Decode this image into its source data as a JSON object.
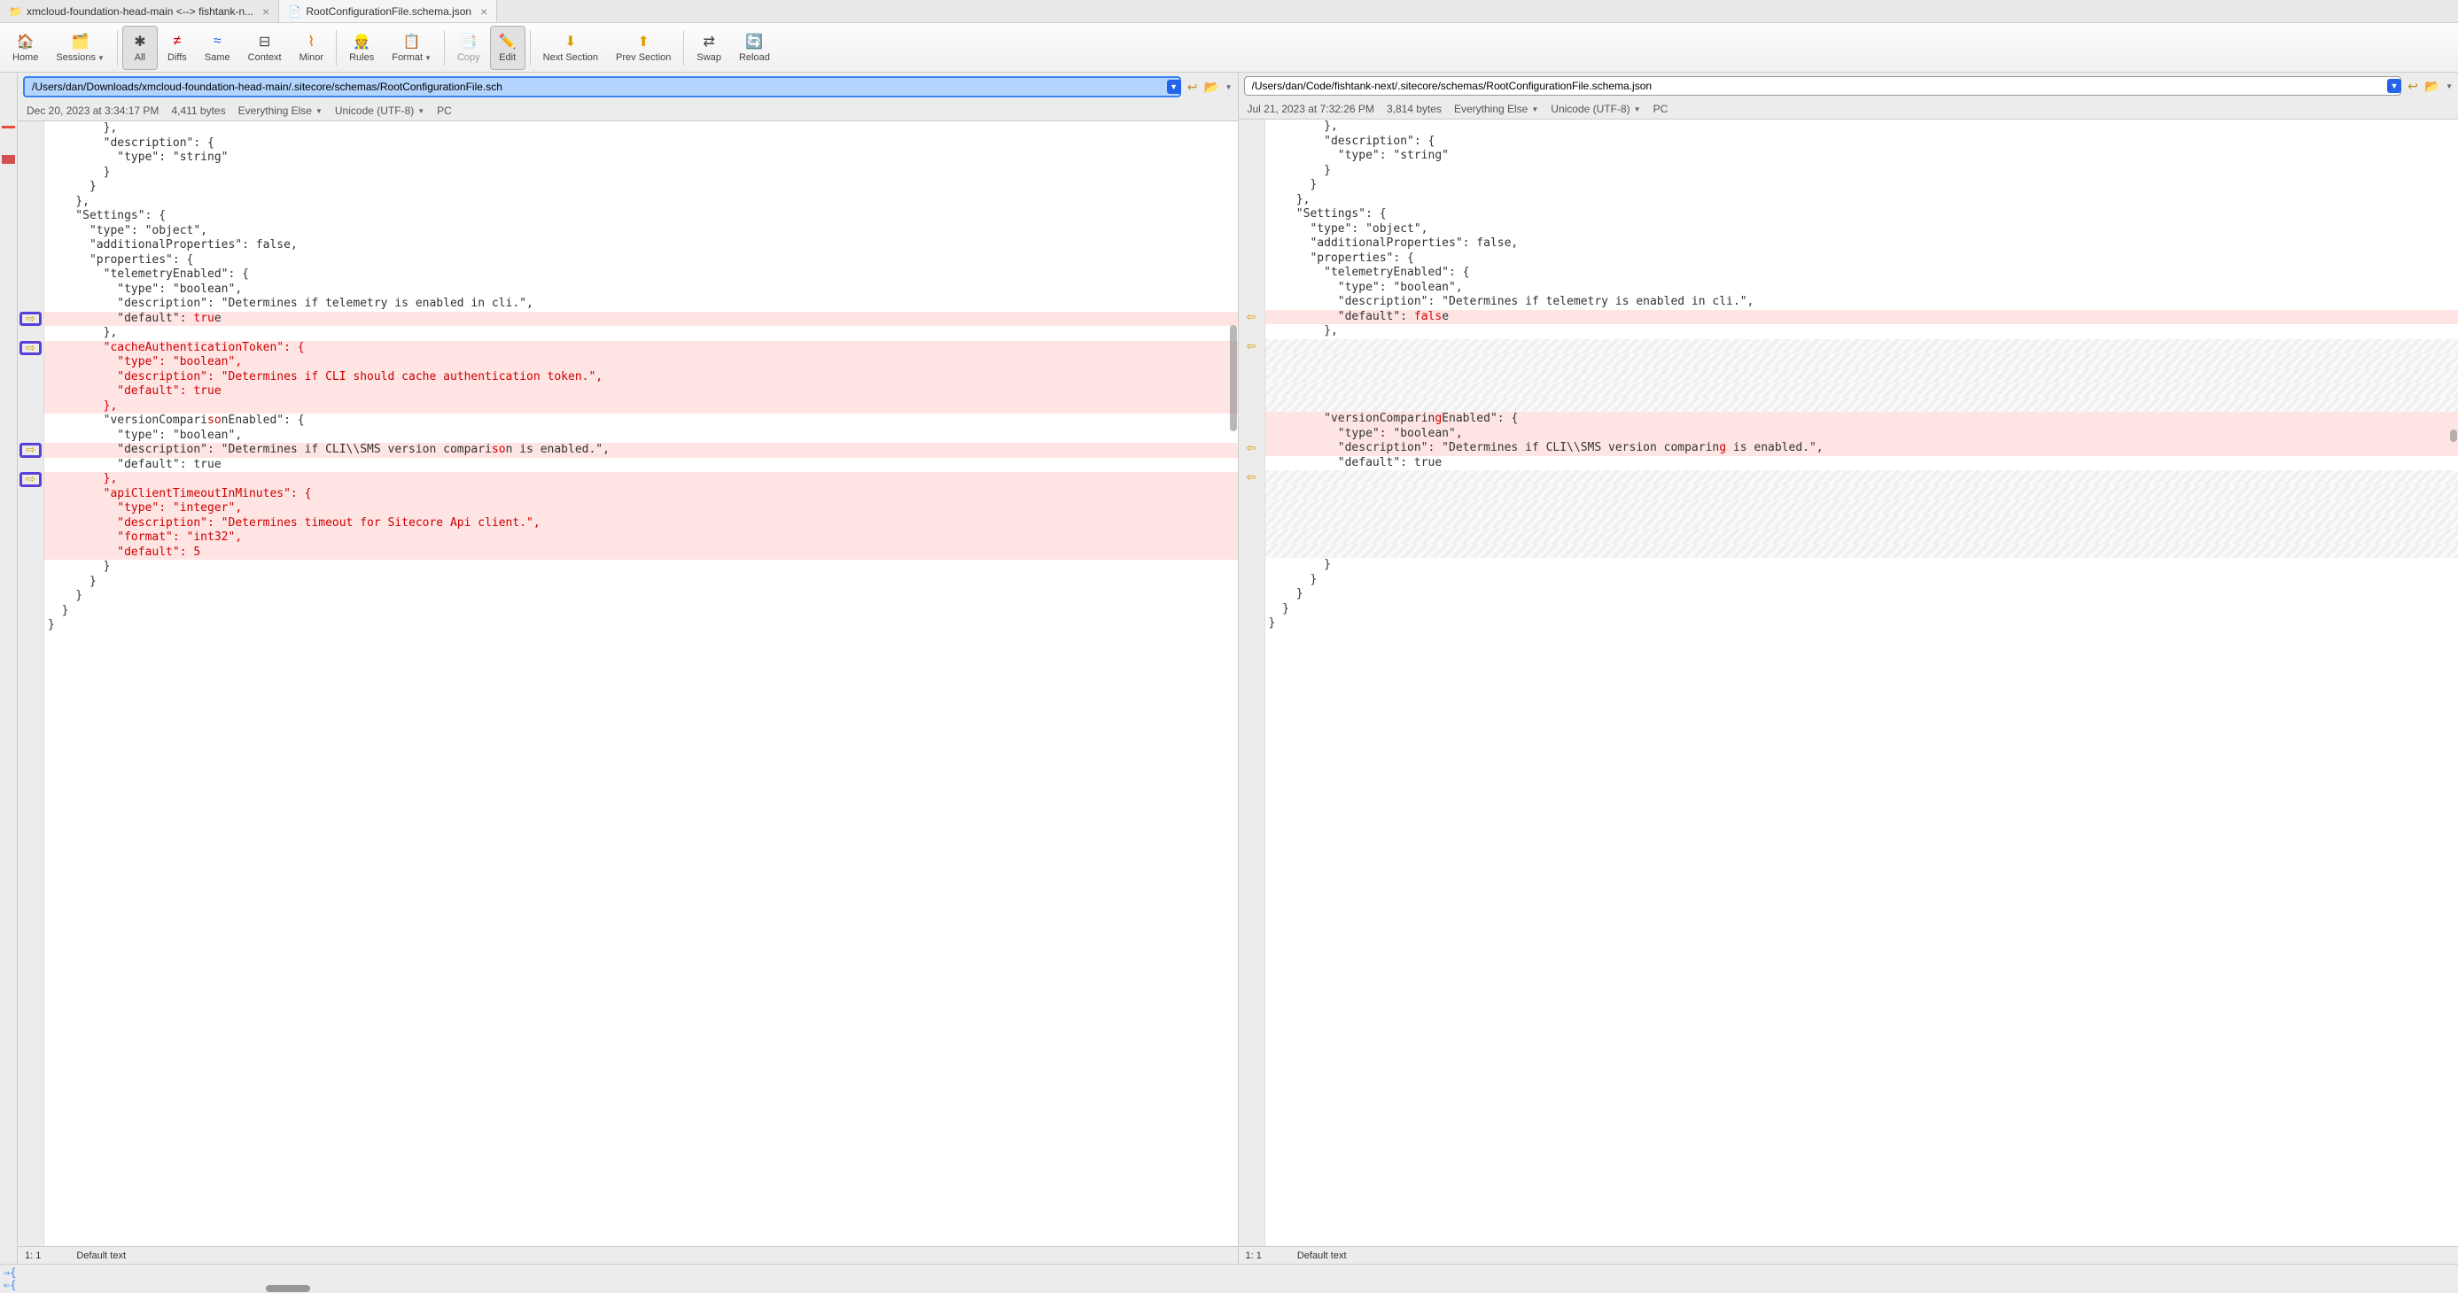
{
  "tabs": [
    {
      "label": "xmcloud-foundation-head-main <--> fishtank-n...",
      "icon": "folder"
    },
    {
      "label": "RootConfigurationFile.schema.json",
      "icon": "file",
      "active": true
    }
  ],
  "toolbar": {
    "home": "Home",
    "sessions": "Sessions",
    "all": "All",
    "diffs": "Diffs",
    "same": "Same",
    "context": "Context",
    "minor": "Minor",
    "rules": "Rules",
    "format": "Format",
    "copy": "Copy",
    "edit": "Edit",
    "next_section": "Next Section",
    "prev_section": "Prev Section",
    "swap": "Swap",
    "reload": "Reload"
  },
  "left": {
    "path": "/Users/dan/Downloads/xmcloud-foundation-head-main/.sitecore/schemas/RootConfigurationFile.sch",
    "date": "Dec 20, 2023 at 3:34:17 PM",
    "bytes": "4,411 bytes",
    "encoding_type": "Everything Else",
    "encoding": "Unicode (UTF-8)",
    "line_ending": "PC",
    "cursor": "1: 1",
    "lang": "Default text"
  },
  "right": {
    "path": "/Users/dan/Code/fishtank-next/.sitecore/schemas/RootConfigurationFile.schema.json",
    "date": "Jul 21, 2023 at 7:32:26 PM",
    "bytes": "3,814 bytes",
    "encoding_type": "Everything Else",
    "encoding": "Unicode (UTF-8)",
    "line_ending": "PC",
    "cursor": "1: 1",
    "lang": "Default text"
  },
  "code_left": [
    {
      "t": "        },",
      "c": ""
    },
    {
      "t": "        \"description\": {",
      "c": ""
    },
    {
      "t": "          \"type\": \"string\"",
      "c": ""
    },
    {
      "t": "        }",
      "c": ""
    },
    {
      "t": "      }",
      "c": ""
    },
    {
      "t": "    },",
      "c": ""
    },
    {
      "t": "    \"Settings\": {",
      "c": ""
    },
    {
      "t": "      \"type\": \"object\",",
      "c": ""
    },
    {
      "t": "      \"additionalProperties\": false,",
      "c": ""
    },
    {
      "t": "      \"properties\": {",
      "c": ""
    },
    {
      "t": "        \"telemetryEnabled\": {",
      "c": ""
    },
    {
      "t": "          \"type\": \"boolean\",",
      "c": ""
    },
    {
      "t": "          \"description\": \"Determines if telemetry is enabled in cli.\",",
      "c": ""
    },
    {
      "t": "          \"default\": true",
      "c": "diff-change",
      "hl": "tru"
    },
    {
      "t": "        },",
      "c": ""
    },
    {
      "t": "        \"cacheAuthenticationToken\": {",
      "c": "diff-change",
      "all_red": true
    },
    {
      "t": "          \"type\": \"boolean\",",
      "c": "diff-change",
      "all_red": true
    },
    {
      "t": "          \"description\": \"Determines if CLI should cache authentication token.\",",
      "c": "diff-change",
      "all_red": true
    },
    {
      "t": "          \"default\": true",
      "c": "diff-change",
      "all_red": true
    },
    {
      "t": "        },",
      "c": "diff-change",
      "all_red": true
    },
    {
      "t": "        \"versionComparisonEnabled\": {",
      "c": "",
      "hl": "so"
    },
    {
      "t": "          \"type\": \"boolean\",",
      "c": ""
    },
    {
      "t": "          \"description\": \"Determines if CLI\\\\SMS version comparison is enabled.\",",
      "c": "diff-change",
      "hl": "so"
    },
    {
      "t": "          \"default\": true",
      "c": ""
    },
    {
      "t": "        },",
      "c": "diff-change",
      "all_red": true
    },
    {
      "t": "        \"apiClientTimeoutInMinutes\": {",
      "c": "diff-change",
      "all_red": true
    },
    {
      "t": "          \"type\": \"integer\",",
      "c": "diff-change",
      "all_red": true
    },
    {
      "t": "          \"description\": \"Determines timeout for Sitecore Api client.\",",
      "c": "diff-change",
      "all_red": true
    },
    {
      "t": "          \"format\": \"int32\",",
      "c": "diff-change",
      "all_red": true
    },
    {
      "t": "          \"default\": 5",
      "c": "diff-change",
      "all_red": true
    },
    {
      "t": "        }",
      "c": ""
    },
    {
      "t": "      }",
      "c": ""
    },
    {
      "t": "    }",
      "c": ""
    },
    {
      "t": "  }",
      "c": ""
    },
    {
      "t": "}",
      "c": ""
    }
  ],
  "code_right": [
    {
      "t": "        },",
      "c": ""
    },
    {
      "t": "        \"description\": {",
      "c": ""
    },
    {
      "t": "          \"type\": \"string\"",
      "c": ""
    },
    {
      "t": "        }",
      "c": ""
    },
    {
      "t": "      }",
      "c": ""
    },
    {
      "t": "    },",
      "c": ""
    },
    {
      "t": "    \"Settings\": {",
      "c": ""
    },
    {
      "t": "      \"type\": \"object\",",
      "c": ""
    },
    {
      "t": "      \"additionalProperties\": false,",
      "c": ""
    },
    {
      "t": "      \"properties\": {",
      "c": ""
    },
    {
      "t": "        \"telemetryEnabled\": {",
      "c": ""
    },
    {
      "t": "          \"type\": \"boolean\",",
      "c": ""
    },
    {
      "t": "          \"description\": \"Determines if telemetry is enabled in cli.\",",
      "c": ""
    },
    {
      "t": "          \"default\": false",
      "c": "diff-change",
      "hl": "fals"
    },
    {
      "t": "        },",
      "c": ""
    },
    {
      "t": "",
      "c": "diff-miss"
    },
    {
      "t": "",
      "c": "diff-miss"
    },
    {
      "t": "",
      "c": "diff-miss"
    },
    {
      "t": "",
      "c": "diff-miss"
    },
    {
      "t": "",
      "c": "diff-miss"
    },
    {
      "t": "        \"versionComparingEnabled\": {",
      "c": "diff-change",
      "hl": "g"
    },
    {
      "t": "          \"type\": \"boolean\",",
      "c": "diff-change"
    },
    {
      "t": "          \"description\": \"Determines if CLI\\\\SMS version comparing is enabled.\",",
      "c": "diff-change",
      "hl": "g"
    },
    {
      "t": "          \"default\": true",
      "c": ""
    },
    {
      "t": "",
      "c": "diff-miss"
    },
    {
      "t": "",
      "c": "diff-miss"
    },
    {
      "t": "",
      "c": "diff-miss"
    },
    {
      "t": "",
      "c": "diff-miss"
    },
    {
      "t": "",
      "c": "diff-miss"
    },
    {
      "t": "",
      "c": "diff-miss"
    },
    {
      "t": "        }",
      "c": ""
    },
    {
      "t": "      }",
      "c": ""
    },
    {
      "t": "    }",
      "c": ""
    },
    {
      "t": "  }",
      "c": ""
    },
    {
      "t": "}",
      "c": ""
    }
  ],
  "left_arrows": [
    13,
    15,
    22,
    24
  ],
  "right_arrows": [
    13,
    15,
    22,
    24
  ],
  "bottom": {
    "line1": "⇒{",
    "line2": "⇐{"
  }
}
